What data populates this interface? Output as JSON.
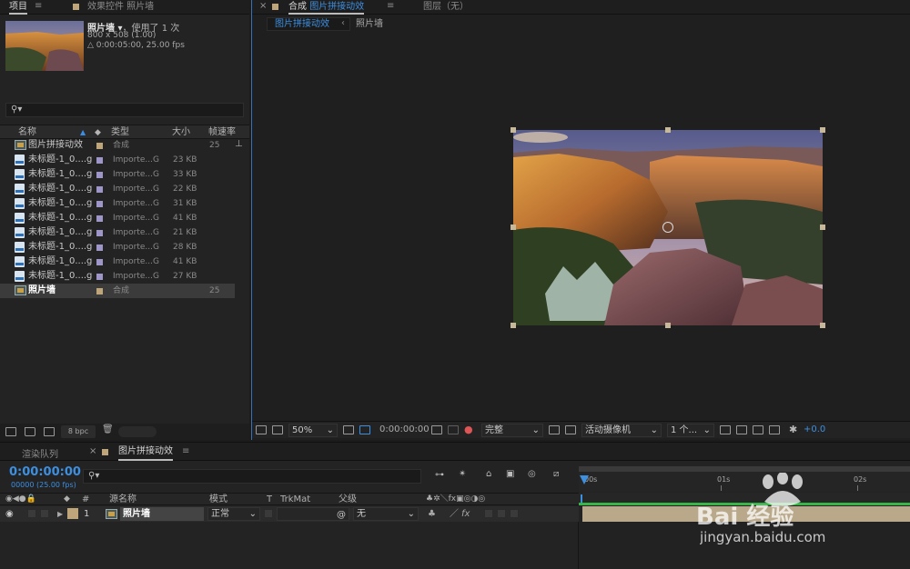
{
  "project": {
    "tab_project": "项目",
    "tab_effects": "效果控件 照片墙",
    "info_name": "照片墙",
    "info_used": "，使用了 1 次",
    "info_size": "800 x 508 (1.00)",
    "info_duration": "△ 0:00:05:00, 25.00 fps",
    "search_placeholder": "",
    "col_name": "名称",
    "col_type": "类型",
    "col_size": "大小",
    "col_fps": "帧速率",
    "items": [
      {
        "name": "图片拼接动效",
        "type": "合成",
        "size": "",
        "fps": "25",
        "kind": "comp",
        "swatch": "#bfa67a"
      },
      {
        "name": "未标题-1_0....g",
        "type": "Importe...G",
        "size": "23 KB",
        "fps": "",
        "kind": "file",
        "swatch": "#9e95c8"
      },
      {
        "name": "未标题-1_0....g",
        "type": "Importe...G",
        "size": "33 KB",
        "fps": "",
        "kind": "file",
        "swatch": "#9e95c8"
      },
      {
        "name": "未标题-1_0....g",
        "type": "Importe...G",
        "size": "22 KB",
        "fps": "",
        "kind": "file",
        "swatch": "#9e95c8"
      },
      {
        "name": "未标题-1_0....g",
        "type": "Importe...G",
        "size": "31 KB",
        "fps": "",
        "kind": "file",
        "swatch": "#9e95c8"
      },
      {
        "name": "未标题-1_0....g",
        "type": "Importe...G",
        "size": "41 KB",
        "fps": "",
        "kind": "file",
        "swatch": "#9e95c8"
      },
      {
        "name": "未标题-1_0....g",
        "type": "Importe...G",
        "size": "21 KB",
        "fps": "",
        "kind": "file",
        "swatch": "#9e95c8"
      },
      {
        "name": "未标题-1_0....g",
        "type": "Importe...G",
        "size": "28 KB",
        "fps": "",
        "kind": "file",
        "swatch": "#9e95c8"
      },
      {
        "name": "未标题-1_0....g",
        "type": "Importe...G",
        "size": "41 KB",
        "fps": "",
        "kind": "file",
        "swatch": "#9e95c8"
      },
      {
        "name": "未标题-1_0....g",
        "type": "Importe...G",
        "size": "27 KB",
        "fps": "",
        "kind": "file",
        "swatch": "#9e95c8"
      },
      {
        "name": "照片墙",
        "type": "合成",
        "size": "",
        "fps": "25",
        "kind": "comp",
        "swatch": "#bfa67a",
        "selected": true
      }
    ],
    "bpc": "8 bpc"
  },
  "comp": {
    "tab_label": "合成",
    "tab_name": "图片拼接动效",
    "layer_tab": "图层（无）",
    "crumb_active": "图片拼接动效",
    "crumb_next": "照片墙",
    "zoom": "50%",
    "timecode": "0:00:00:00",
    "resolution": "完整",
    "camera": "活动摄像机",
    "views": "1 个...",
    "exposure": "+0.0"
  },
  "timeline": {
    "tab_render": "渲染队列",
    "tab_comp": "图片拼接动效",
    "timecode": "0:00:00:00",
    "timecode_sub": "00000 (25.00 fps)",
    "col_num": "#",
    "col_source": "源名称",
    "col_mode": "模式",
    "col_t": "T",
    "col_trkmat": "TrkMat",
    "col_parent": "父级",
    "ruler": [
      "00s",
      "01s",
      "02s"
    ],
    "layer": {
      "num": "1",
      "name": "照片墙",
      "mode": "正常",
      "parent": "无"
    }
  },
  "watermark": {
    "logo": "Bai 经验",
    "url": "jingyan.baidu.com"
  },
  "colors": {
    "accent": "#2d8ceb",
    "comp_label": "#bfa67a",
    "footage_label": "#9e95c8",
    "track_bar": "#b9a98a"
  }
}
